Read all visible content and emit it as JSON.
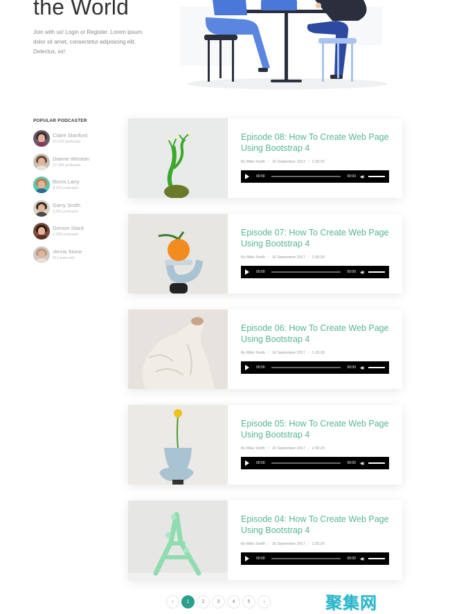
{
  "hero": {
    "title": "the World",
    "text": "Join with us! Login or Register. Lorem ipsum dolor sit amet, consectetur adipisicing elit. Delectus, ex!"
  },
  "sidebar": {
    "heading": "POPULAR PODCASTER",
    "podcasters": [
      {
        "name": "Claire Stanford",
        "count": "22,420 podcasts"
      },
      {
        "name": "Dianne Winston",
        "count": "12,381 podcasts"
      },
      {
        "name": "Borris Larry",
        "count": "8,291 podcasts"
      },
      {
        "name": "Garry Smith",
        "count": "3,391 podcasts"
      },
      {
        "name": "Gerson Stack",
        "count": "1,392 podcasts"
      },
      {
        "name": "Jenna Stone",
        "count": "911 podcasts"
      }
    ]
  },
  "episodes": [
    {
      "title": "Episode 08: How To Create Web Page Using Bootstrap 4",
      "author": "By Mike Smith",
      "date": "16 September 2017",
      "duration": "1:30:20",
      "current_time": "00:00",
      "total_time": "00:00",
      "image_icon": "plant-sculpture"
    },
    {
      "title": "Episode 07: How To Create Web Page Using Bootstrap 4",
      "author": "By Mike Smith",
      "date": "16 September 2017",
      "duration": "1:30:20",
      "current_time": "00:00",
      "total_time": "00:00",
      "image_icon": "orange-sculpture"
    },
    {
      "title": "Episode 06: How To Create Web Page Using Bootstrap 4",
      "author": "By Mike Smith",
      "date": "16 September 2017",
      "duration": "1:30:20",
      "current_time": "00:00",
      "total_time": "00:00",
      "image_icon": "sweater-sculpture"
    },
    {
      "title": "Episode 05: How To Create Web Page Using Bootstrap 4",
      "author": "By Mike Smith",
      "date": "16 September 2017",
      "duration": "1:30:20",
      "current_time": "00:00",
      "total_time": "00:00",
      "image_icon": "flower-vase"
    },
    {
      "title": "Episode 04: How To Create Web Page Using Bootstrap 4",
      "author": "By Mike Smith",
      "date": "16 September 2017",
      "duration": "1:30:20",
      "current_time": "00:00",
      "total_time": "00:00",
      "image_icon": "green-tower"
    }
  ],
  "pagination": {
    "prev": "‹",
    "pages": [
      "1",
      "2",
      "3",
      "4",
      "5"
    ],
    "active": "1",
    "next": "›"
  },
  "watermark": "聚集网",
  "colors": {
    "accent": "#55b497",
    "active_page": "#2aa08a",
    "player_bg": "#000000",
    "watermark": "#2bb6c9"
  }
}
